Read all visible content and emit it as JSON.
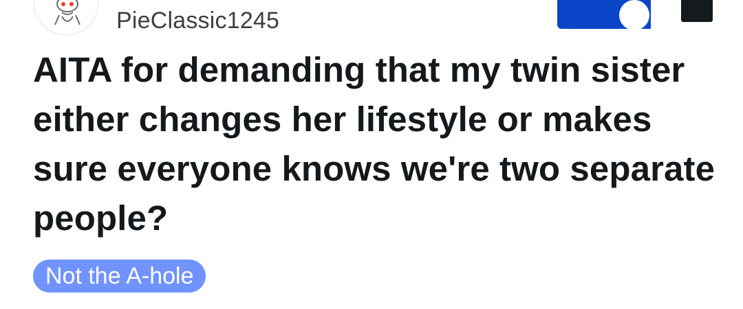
{
  "post": {
    "author": "PieClassic1245",
    "title": "AITA for demanding that my twin sister either changes her lifestyle or makes sure everyone knows we're two separate people?",
    "flair": "Not the A-hole"
  },
  "colors": {
    "flair_bg": "#7193ff",
    "toggle_bg": "#0a45c7",
    "title_text": "#15191c"
  },
  "icons": [
    "reddit-snoo-icon",
    "toggle-knob-icon"
  ]
}
